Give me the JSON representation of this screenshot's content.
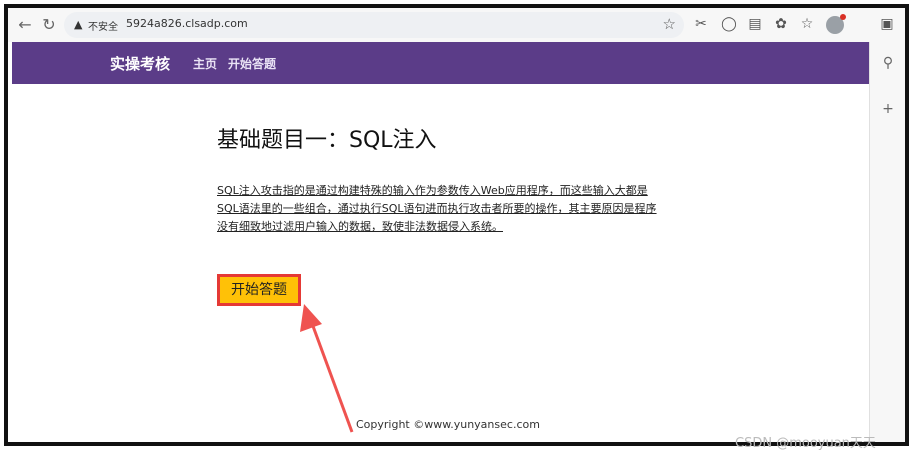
{
  "browser": {
    "back_icon": "arrow-left-icon",
    "reload_icon": "reload-icon",
    "security_label": "不安全",
    "url": "5924a826.clsadp.com"
  },
  "site": {
    "brand": "实操考核",
    "nav": [
      {
        "label": "主页"
      },
      {
        "label": "开始答题"
      }
    ]
  },
  "main": {
    "title": "基础题目一：SQL注入",
    "description": "SQL注入攻击指的是通过构建特殊的输入作为参数传入Web应用程序，而这些输入大都是SQL语法里的一些组合，通过执行SQL语句进而执行攻击者所要的操作，其主要原因是程序没有细致地过滤用户输入的数据，致使非法数据侵入系统。",
    "start_button": "开始答题"
  },
  "footer": {
    "copyright": "Copyright ©www.yunyansec.com"
  },
  "watermark": "CSDN @mooyuan天天",
  "colors": {
    "nav_bg": "#5b3c88",
    "button_bg": "#ffc107",
    "highlight": "#e53935"
  }
}
